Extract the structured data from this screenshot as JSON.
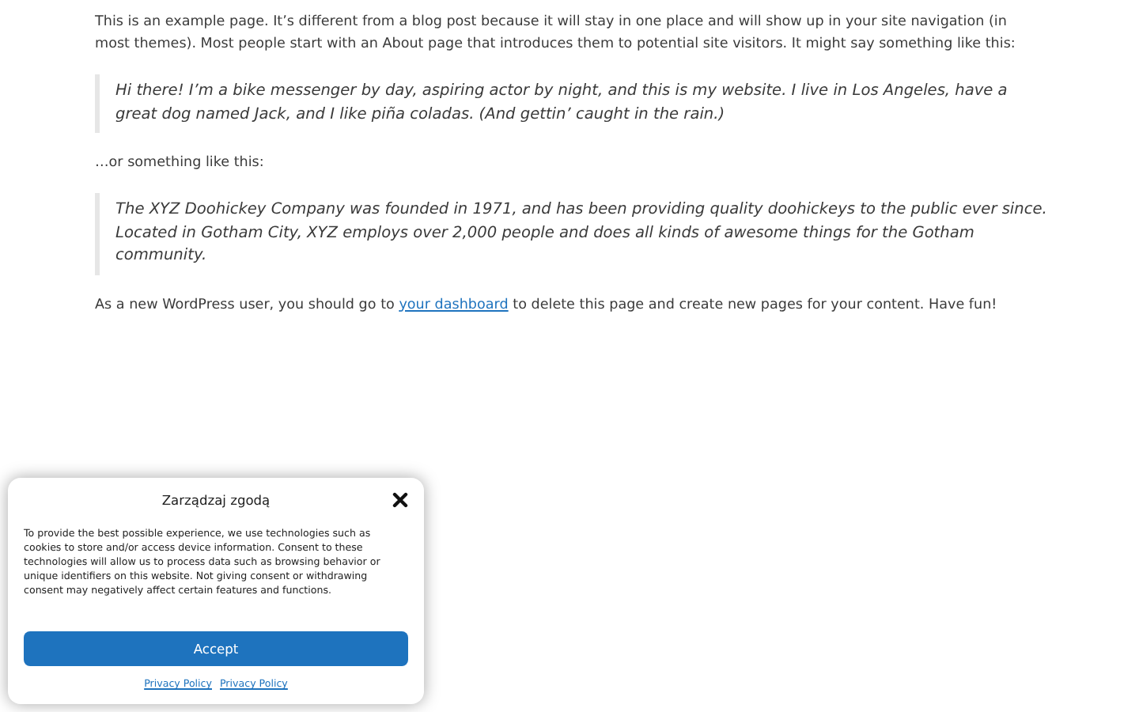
{
  "content": {
    "intro": "This is an example page. It’s different from a blog post because it will stay in one place and will show up in your site navigation (in most themes). Most people start with an About page that introduces them to potential site visitors. It might say something like this:",
    "quote_1": "Hi there! I’m a bike messenger by day, aspiring actor by night, and this is my website. I live in Los Angeles, have a great dog named Jack, and I like piña coladas. (And gettin’ caught in the rain.)",
    "middle": "…or something like this:",
    "quote_2": "The XYZ Doohickey Company was founded in 1971, and has been providing quality doohickeys to the public ever since. Located in Gotham City, XYZ employs over 2,000 people and does all kinds of awesome things for the Gotham community.",
    "outro_before": "As a new WordPress user, you should go to",
    "outro_link": "your dashboard",
    "outro_after": "to delete this page and create new pages for your content. Have fun!"
  },
  "consent": {
    "title": "Zarządzaj zgodą",
    "body": "To provide the best possible experience, we use technologies such as cookies to store and/or access device information. Consent to these technologies will allow us to process data such as browsing behavior or unique identifiers on this website. Not giving consent or withdrawing consent may negatively affect certain features and functions.",
    "button": "Accept",
    "links": [
      "Privacy Policy",
      "Privacy Policy"
    ]
  }
}
